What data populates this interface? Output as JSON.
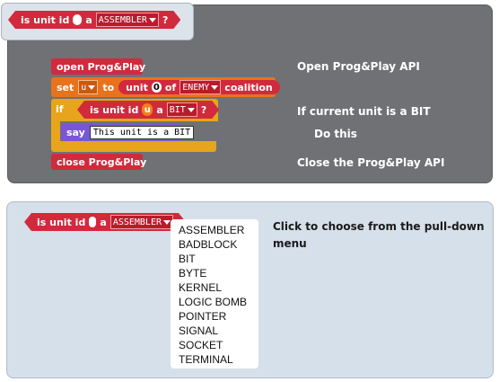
{
  "top_predicate": {
    "text_is_unit_id": "is unit id",
    "text_a": "a",
    "dropdown_value": "ASSEMBLER",
    "question_mark": "?"
  },
  "script": {
    "open_block": "open Prog&Play",
    "set_block": {
      "set": "set",
      "var": "u",
      "to": "to",
      "unit": "unit",
      "index": "0",
      "of": "of",
      "coalition_value": "ENEMY",
      "coalition": "coalition"
    },
    "if_block": {
      "if": "if",
      "is_unit_id": "is unit id",
      "var": "u",
      "a": "a",
      "type_value": "BIT",
      "question_mark": "?"
    },
    "say_block": {
      "say": "say",
      "message": "This unit is a BIT"
    },
    "close_block": "close Prog&Play"
  },
  "annotations": {
    "open": "Open Prog&Play API",
    "if": "If current unit is a BIT",
    "do": "Do this",
    "close": "Close the Prog&Play API"
  },
  "example": {
    "predicate": {
      "text_is_unit_id": "is unit id",
      "text_a": "a",
      "dropdown_value": "ASSEMBLER"
    },
    "hint": "Click to choose from the pull-down menu",
    "menu_options": [
      "ASSEMBLER",
      "BADBLOCK",
      "BIT",
      "BYTE",
      "KERNEL",
      "LOGIC BOMB",
      "POINTER",
      "SIGNAL",
      "SOCKET",
      "TERMINAL"
    ]
  },
  "colors": {
    "predicate_red": "#d12a3c",
    "variable_orange": "#e8731c",
    "control_yellow": "#e6a51c",
    "looks_purple": "#7a55d6",
    "dark_panel": "#6f7174",
    "light_panel": "#d6e0ea"
  }
}
